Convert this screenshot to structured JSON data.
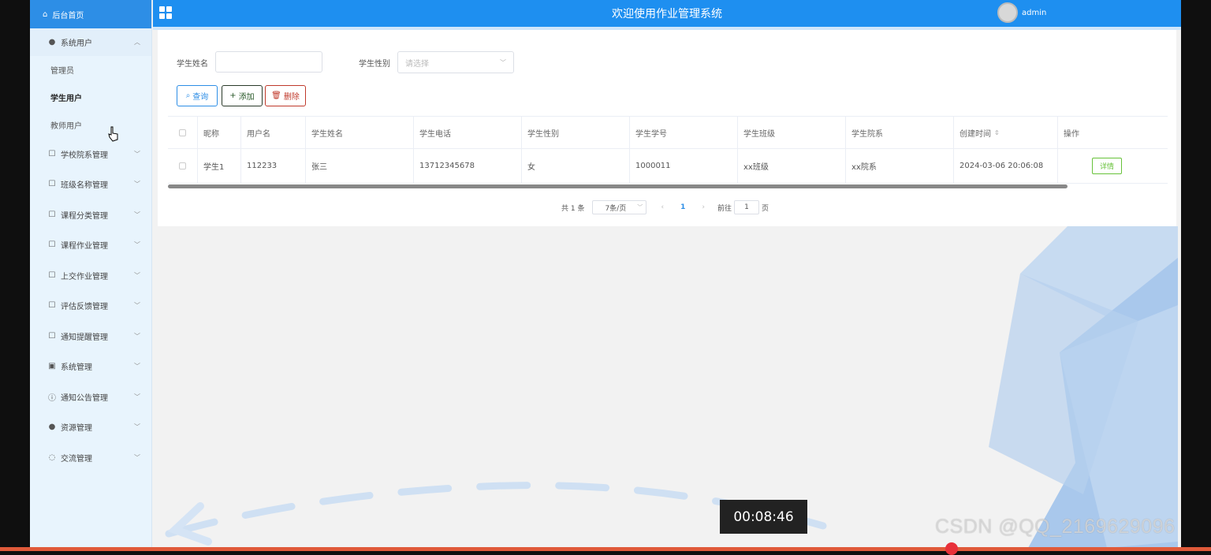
{
  "sidebar": {
    "home": "后台首页",
    "system_users": {
      "label": "系统用户",
      "children": [
        "管理员",
        "学生用户",
        "教师用户"
      ]
    },
    "groups": [
      {
        "label": "学校院系管理",
        "icon": "doc-icon"
      },
      {
        "label": "班级名称管理",
        "icon": "doc-icon"
      },
      {
        "label": "课程分类管理",
        "icon": "doc-icon"
      },
      {
        "label": "课程作业管理",
        "icon": "doc-icon"
      },
      {
        "label": "上交作业管理",
        "icon": "doc-icon"
      },
      {
        "label": "评估反馈管理",
        "icon": "doc-icon"
      },
      {
        "label": "通知提醒管理",
        "icon": "doc-icon"
      },
      {
        "label": "系统管理",
        "icon": "image-icon"
      },
      {
        "label": "通知公告管理",
        "icon": "info-icon"
      },
      {
        "label": "资源管理",
        "icon": "pin-icon"
      },
      {
        "label": "交流管理",
        "icon": "chat-icon"
      }
    ]
  },
  "header": {
    "title": "欢迎使用作业管理系统",
    "username": "admin"
  },
  "search": {
    "name_label": "学生姓名",
    "name_value": "",
    "gender_label": "学生性别",
    "gender_placeholder": "请选择"
  },
  "buttons": {
    "query": "查询",
    "add": "添加",
    "delete": "删除"
  },
  "table": {
    "headers": [
      "昵称",
      "用户名",
      "学生姓名",
      "学生电话",
      "学生性别",
      "学生学号",
      "学生班级",
      "学生院系",
      "创建时间",
      "操作"
    ],
    "rows": [
      {
        "nickname": "学生1",
        "username": "112233",
        "name": "张三",
        "phone": "13712345678",
        "gender": "女",
        "student_no": "1000011",
        "class": "xx班级",
        "dept": "xx院系",
        "created": "2024-03-06 20:06:08",
        "action": "详情"
      }
    ]
  },
  "pagination": {
    "total": "共 1 条",
    "page_size": "7条/页",
    "current": "1",
    "goto_label": "前往",
    "goto_value": "1",
    "page_suffix": "页"
  },
  "video": {
    "timestamp": "00:08:46",
    "watermark": "CSDN @QQ_2169629096"
  },
  "colors": {
    "header": "#1e8ff0",
    "sidebar": "#e8f4fd",
    "detail": "#67c23a",
    "delete": "#c0392b"
  }
}
